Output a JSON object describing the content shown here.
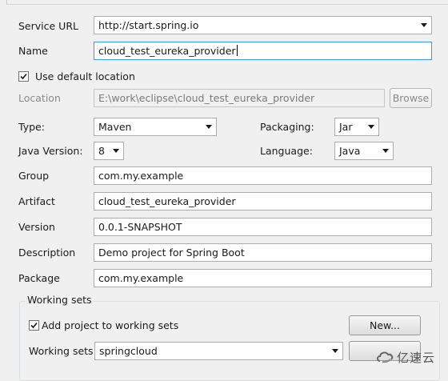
{
  "form": {
    "service_url": {
      "label": "Service URL",
      "value": "http://start.spring.io"
    },
    "name": {
      "label": "Name",
      "value": "cloud_test_eureka_provider"
    },
    "use_default_location": {
      "label": "Use default location",
      "checked": true
    },
    "location": {
      "label": "Location",
      "value": "E:\\work\\eclipse\\cloud_test_eureka_provider",
      "browse_label": "Browse"
    },
    "type": {
      "label": "Type:",
      "value": "Maven"
    },
    "packaging": {
      "label": "Packaging:",
      "value": "Jar"
    },
    "java_version": {
      "label": "Java Version:",
      "value": "8"
    },
    "language": {
      "label": "Language:",
      "value": "Java"
    },
    "group": {
      "label": "Group",
      "value": "com.my.example"
    },
    "artifact": {
      "label": "Artifact",
      "value": "cloud_test_eureka_provider"
    },
    "version": {
      "label": "Version",
      "value": "0.0.1-SNAPSHOT"
    },
    "description": {
      "label": "Description",
      "value": "Demo project for Spring Boot"
    },
    "package": {
      "label": "Package",
      "value": "com.my.example"
    }
  },
  "working_sets": {
    "title": "Working sets",
    "add_label": "Add project to working sets",
    "add_checked": true,
    "new_label": "New...",
    "sets_label": "Working sets:",
    "sets_value": "springcloud"
  },
  "watermark": {
    "text": "亿速云",
    "icon": "yisu-cloud-logo-icon"
  },
  "colors": {
    "focus_border": "#3399ff",
    "background": "#f0f0f0"
  }
}
